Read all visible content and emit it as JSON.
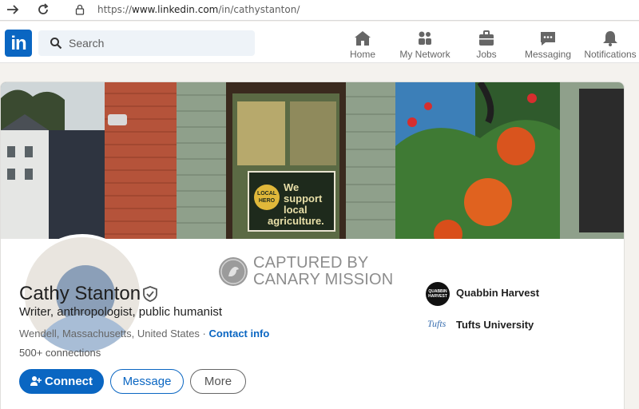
{
  "browser": {
    "url_prefix": "https://",
    "url_domain": "www.linkedin.com",
    "url_path": "/in/cathystanton/",
    "back_icon": "back-arrow-icon",
    "reload_icon": "reload-icon"
  },
  "nav": {
    "logo": "in",
    "search_placeholder": "Search",
    "items": [
      {
        "label": "Home",
        "icon": "home-icon"
      },
      {
        "label": "My Network",
        "icon": "network-icon"
      },
      {
        "label": "Jobs",
        "icon": "briefcase-icon"
      },
      {
        "label": "Messaging",
        "icon": "chat-icon"
      },
      {
        "label": "Notifications",
        "icon": "bell-icon"
      }
    ]
  },
  "cover": {
    "sign_text": [
      "We",
      "support",
      "local",
      "agriculture."
    ],
    "sticker_text": [
      "LOCAL",
      "HERO"
    ]
  },
  "watermark": {
    "line1": "CAPTURED BY",
    "line2": "CANARY MISSION"
  },
  "profile": {
    "name": "Cathy Stanton",
    "headline": "Writer, anthropologist, public humanist",
    "location": "Wendell, Massachusetts, United States",
    "separator": " · ",
    "contact_label": "Contact info",
    "connections": "500+ connections"
  },
  "actions": {
    "connect_label": "Connect",
    "message_label": "Message",
    "more_label": "More"
  },
  "orgs": [
    {
      "name": "Quabbin Harvest",
      "logo_text": "QUABBIN HARVEST"
    },
    {
      "name": "Tufts University",
      "logo_text": "Tufts"
    }
  ],
  "colors": {
    "brand_blue": "#0a66c2",
    "page_bg": "#f4f2ee"
  }
}
